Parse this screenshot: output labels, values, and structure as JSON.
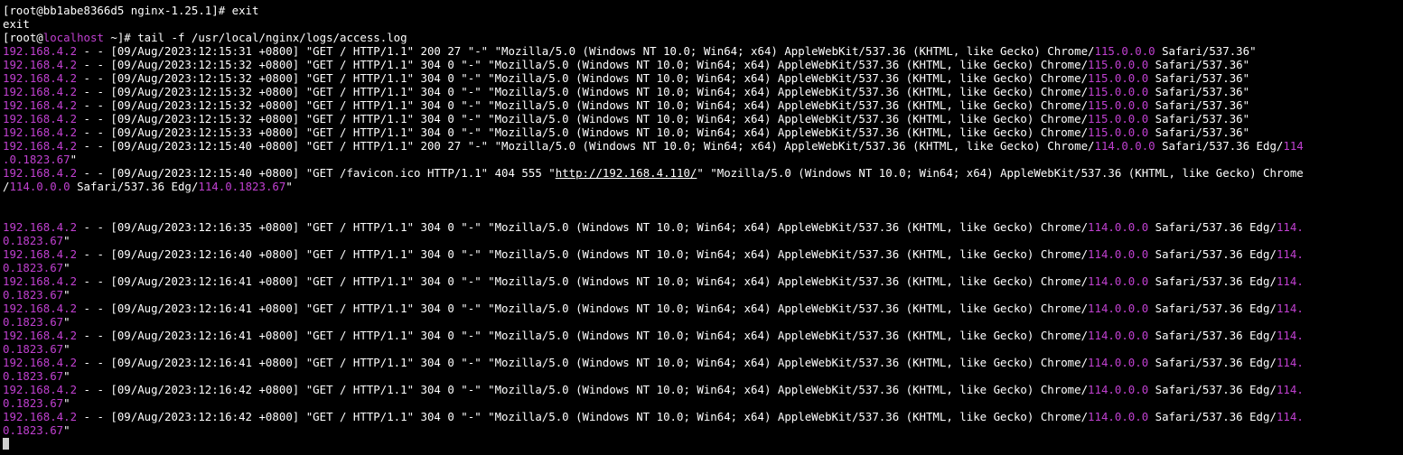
{
  "colors": {
    "background": "#000000",
    "text": "#ffffff",
    "highlight": "#c040d0"
  },
  "lines": [
    {
      "segs": [
        {
          "t": "[root@bb1abe8366d5 nginx-1.25.1]# exit"
        }
      ]
    },
    {
      "segs": [
        {
          "t": "exit"
        }
      ]
    },
    {
      "segs": [
        {
          "t": "[root@"
        },
        {
          "t": "localhost",
          "c": "ip"
        },
        {
          "t": " ~]# tail -f /usr/local/nginx/logs/access.log"
        }
      ]
    },
    {
      "segs": [
        {
          "t": "192.168.4.2",
          "c": "ip"
        },
        {
          "t": " - - [09/Aug/2023:12:15:31 +0800] \"GET / HTTP/1.1\" 200 27 \"-\" \"Mozilla/5.0 (Windows NT 10.0; Win64; x64) AppleWebKit/537.36 (KHTML, like Gecko) Chrome/"
        },
        {
          "t": "115.0.0.0",
          "c": "ver"
        },
        {
          "t": " Safari/537.36\""
        }
      ]
    },
    {
      "segs": [
        {
          "t": "192.168.4.2",
          "c": "ip"
        },
        {
          "t": " - - [09/Aug/2023:12:15:32 +0800] \"GET / HTTP/1.1\" 304 0 \"-\" \"Mozilla/5.0 (Windows NT 10.0; Win64; x64) AppleWebKit/537.36 (KHTML, like Gecko) Chrome/"
        },
        {
          "t": "115.0.0.0",
          "c": "ver"
        },
        {
          "t": " Safari/537.36\""
        }
      ]
    },
    {
      "segs": [
        {
          "t": "192.168.4.2",
          "c": "ip"
        },
        {
          "t": " - - [09/Aug/2023:12:15:32 +0800] \"GET / HTTP/1.1\" 304 0 \"-\" \"Mozilla/5.0 (Windows NT 10.0; Win64; x64) AppleWebKit/537.36 (KHTML, like Gecko) Chrome/"
        },
        {
          "t": "115.0.0.0",
          "c": "ver"
        },
        {
          "t": " Safari/537.36\""
        }
      ]
    },
    {
      "segs": [
        {
          "t": "192.168.4.2",
          "c": "ip"
        },
        {
          "t": " - - [09/Aug/2023:12:15:32 +0800] \"GET / HTTP/1.1\" 304 0 \"-\" \"Mozilla/5.0 (Windows NT 10.0; Win64; x64) AppleWebKit/537.36 (KHTML, like Gecko) Chrome/"
        },
        {
          "t": "115.0.0.0",
          "c": "ver"
        },
        {
          "t": " Safari/537.36\""
        }
      ]
    },
    {
      "segs": [
        {
          "t": "192.168.4.2",
          "c": "ip"
        },
        {
          "t": " - - [09/Aug/2023:12:15:32 +0800] \"GET / HTTP/1.1\" 304 0 \"-\" \"Mozilla/5.0 (Windows NT 10.0; Win64; x64) AppleWebKit/537.36 (KHTML, like Gecko) Chrome/"
        },
        {
          "t": "115.0.0.0",
          "c": "ver"
        },
        {
          "t": " Safari/537.36\""
        }
      ]
    },
    {
      "segs": [
        {
          "t": "192.168.4.2",
          "c": "ip"
        },
        {
          "t": " - - [09/Aug/2023:12:15:32 +0800] \"GET / HTTP/1.1\" 304 0 \"-\" \"Mozilla/5.0 (Windows NT 10.0; Win64; x64) AppleWebKit/537.36 (KHTML, like Gecko) Chrome/"
        },
        {
          "t": "115.0.0.0",
          "c": "ver"
        },
        {
          "t": " Safari/537.36\""
        }
      ]
    },
    {
      "segs": [
        {
          "t": "192.168.4.2",
          "c": "ip"
        },
        {
          "t": " - - [09/Aug/2023:12:15:33 +0800] \"GET / HTTP/1.1\" 304 0 \"-\" \"Mozilla/5.0 (Windows NT 10.0; Win64; x64) AppleWebKit/537.36 (KHTML, like Gecko) Chrome/"
        },
        {
          "t": "115.0.0.0",
          "c": "ver"
        },
        {
          "t": " Safari/537.36\""
        }
      ]
    },
    {
      "segs": [
        {
          "t": "192.168.4.2",
          "c": "ip"
        },
        {
          "t": " - - [09/Aug/2023:12:15:40 +0800] \"GET / HTTP/1.1\" 200 27 \"-\" \"Mozilla/5.0 (Windows NT 10.0; Win64; x64) AppleWebKit/537.36 (KHTML, like Gecko) Chrome/"
        },
        {
          "t": "114.0.0.0",
          "c": "ver"
        },
        {
          "t": " Safari/537.36 Edg/"
        },
        {
          "t": "114",
          "c": "ver"
        }
      ]
    },
    {
      "segs": [
        {
          "t": ".0.1823.67",
          "c": "ver"
        },
        {
          "t": "\""
        }
      ]
    },
    {
      "segs": [
        {
          "t": "192.168.4.2",
          "c": "ip"
        },
        {
          "t": " - - [09/Aug/2023:12:15:40 +0800] \"GET /favicon.ico HTTP/1.1\" 404 555 \""
        },
        {
          "t": "http://192.168.4.110/",
          "c": "url"
        },
        {
          "t": "\" \"Mozilla/5.0 (Windows NT 10.0; Win64; x64) AppleWebKit/537.36 (KHTML, like Gecko) Chrome"
        }
      ]
    },
    {
      "segs": [
        {
          "t": "/"
        },
        {
          "t": "114.0.0.0",
          "c": "ver"
        },
        {
          "t": " Safari/537.36 Edg/"
        },
        {
          "t": "114.0.1823.67",
          "c": "ver"
        },
        {
          "t": "\""
        }
      ]
    },
    {
      "segs": [
        {
          "t": ""
        }
      ]
    },
    {
      "segs": [
        {
          "t": ""
        }
      ]
    },
    {
      "segs": [
        {
          "t": "192.168.4.2",
          "c": "ip"
        },
        {
          "t": " - - [09/Aug/2023:12:16:35 +0800] \"GET / HTTP/1.1\" 304 0 \"-\" \"Mozilla/5.0 (Windows NT 10.0; Win64; x64) AppleWebKit/537.36 (KHTML, like Gecko) Chrome/"
        },
        {
          "t": "114.0.0.0",
          "c": "ver"
        },
        {
          "t": " Safari/537.36 Edg/"
        },
        {
          "t": "114.",
          "c": "ver"
        }
      ]
    },
    {
      "segs": [
        {
          "t": "0.1823.67",
          "c": "ver"
        },
        {
          "t": "\""
        }
      ]
    },
    {
      "segs": [
        {
          "t": "192.168.4.2",
          "c": "ip"
        },
        {
          "t": " - - [09/Aug/2023:12:16:40 +0800] \"GET / HTTP/1.1\" 304 0 \"-\" \"Mozilla/5.0 (Windows NT 10.0; Win64; x64) AppleWebKit/537.36 (KHTML, like Gecko) Chrome/"
        },
        {
          "t": "114.0.0.0",
          "c": "ver"
        },
        {
          "t": " Safari/537.36 Edg/"
        },
        {
          "t": "114.",
          "c": "ver"
        }
      ]
    },
    {
      "segs": [
        {
          "t": "0.1823.67",
          "c": "ver"
        },
        {
          "t": "\""
        }
      ]
    },
    {
      "segs": [
        {
          "t": "192.168.4.2",
          "c": "ip"
        },
        {
          "t": " - - [09/Aug/2023:12:16:41 +0800] \"GET / HTTP/1.1\" 304 0 \"-\" \"Mozilla/5.0 (Windows NT 10.0; Win64; x64) AppleWebKit/537.36 (KHTML, like Gecko) Chrome/"
        },
        {
          "t": "114.0.0.0",
          "c": "ver"
        },
        {
          "t": " Safari/537.36 Edg/"
        },
        {
          "t": "114.",
          "c": "ver"
        }
      ]
    },
    {
      "segs": [
        {
          "t": "0.1823.67",
          "c": "ver"
        },
        {
          "t": "\""
        }
      ]
    },
    {
      "segs": [
        {
          "t": "192.168.4.2",
          "c": "ip"
        },
        {
          "t": " - - [09/Aug/2023:12:16:41 +0800] \"GET / HTTP/1.1\" 304 0 \"-\" \"Mozilla/5.0 (Windows NT 10.0; Win64; x64) AppleWebKit/537.36 (KHTML, like Gecko) Chrome/"
        },
        {
          "t": "114.0.0.0",
          "c": "ver"
        },
        {
          "t": " Safari/537.36 Edg/"
        },
        {
          "t": "114.",
          "c": "ver"
        }
      ]
    },
    {
      "segs": [
        {
          "t": "0.1823.67",
          "c": "ver"
        },
        {
          "t": "\""
        }
      ]
    },
    {
      "segs": [
        {
          "t": "192.168.4.2",
          "c": "ip"
        },
        {
          "t": " - - [09/Aug/2023:12:16:41 +0800] \"GET / HTTP/1.1\" 304 0 \"-\" \"Mozilla/5.0 (Windows NT 10.0; Win64; x64) AppleWebKit/537.36 (KHTML, like Gecko) Chrome/"
        },
        {
          "t": "114.0.0.0",
          "c": "ver"
        },
        {
          "t": " Safari/537.36 Edg/"
        },
        {
          "t": "114.",
          "c": "ver"
        }
      ]
    },
    {
      "segs": [
        {
          "t": "0.1823.67",
          "c": "ver"
        },
        {
          "t": "\""
        }
      ]
    },
    {
      "segs": [
        {
          "t": "192.168.4.2",
          "c": "ip"
        },
        {
          "t": " - - [09/Aug/2023:12:16:41 +0800] \"GET / HTTP/1.1\" 304 0 \"-\" \"Mozilla/5.0 (Windows NT 10.0; Win64; x64) AppleWebKit/537.36 (KHTML, like Gecko) Chrome/"
        },
        {
          "t": "114.0.0.0",
          "c": "ver"
        },
        {
          "t": " Safari/537.36 Edg/"
        },
        {
          "t": "114.",
          "c": "ver"
        }
      ]
    },
    {
      "segs": [
        {
          "t": "0.1823.67",
          "c": "ver"
        },
        {
          "t": "\""
        }
      ]
    },
    {
      "segs": [
        {
          "t": "192.168.4.2",
          "c": "ip"
        },
        {
          "t": " - - [09/Aug/2023:12:16:42 +0800] \"GET / HTTP/1.1\" 304 0 \"-\" \"Mozilla/5.0 (Windows NT 10.0; Win64; x64) AppleWebKit/537.36 (KHTML, like Gecko) Chrome/"
        },
        {
          "t": "114.0.0.0",
          "c": "ver"
        },
        {
          "t": " Safari/537.36 Edg/"
        },
        {
          "t": "114.",
          "c": "ver"
        }
      ]
    },
    {
      "segs": [
        {
          "t": "0.1823.67",
          "c": "ver"
        },
        {
          "t": "\""
        }
      ]
    },
    {
      "segs": [
        {
          "t": "192.168.4.2",
          "c": "ip"
        },
        {
          "t": " - - [09/Aug/2023:12:16:42 +0800] \"GET / HTTP/1.1\" 304 0 \"-\" \"Mozilla/5.0 (Windows NT 10.0; Win64; x64) AppleWebKit/537.36 (KHTML, like Gecko) Chrome/"
        },
        {
          "t": "114.0.0.0",
          "c": "ver"
        },
        {
          "t": " Safari/537.36 Edg/"
        },
        {
          "t": "114.",
          "c": "ver"
        }
      ]
    },
    {
      "segs": [
        {
          "t": "0.1823.67",
          "c": "ver"
        },
        {
          "t": "\""
        }
      ]
    }
  ]
}
